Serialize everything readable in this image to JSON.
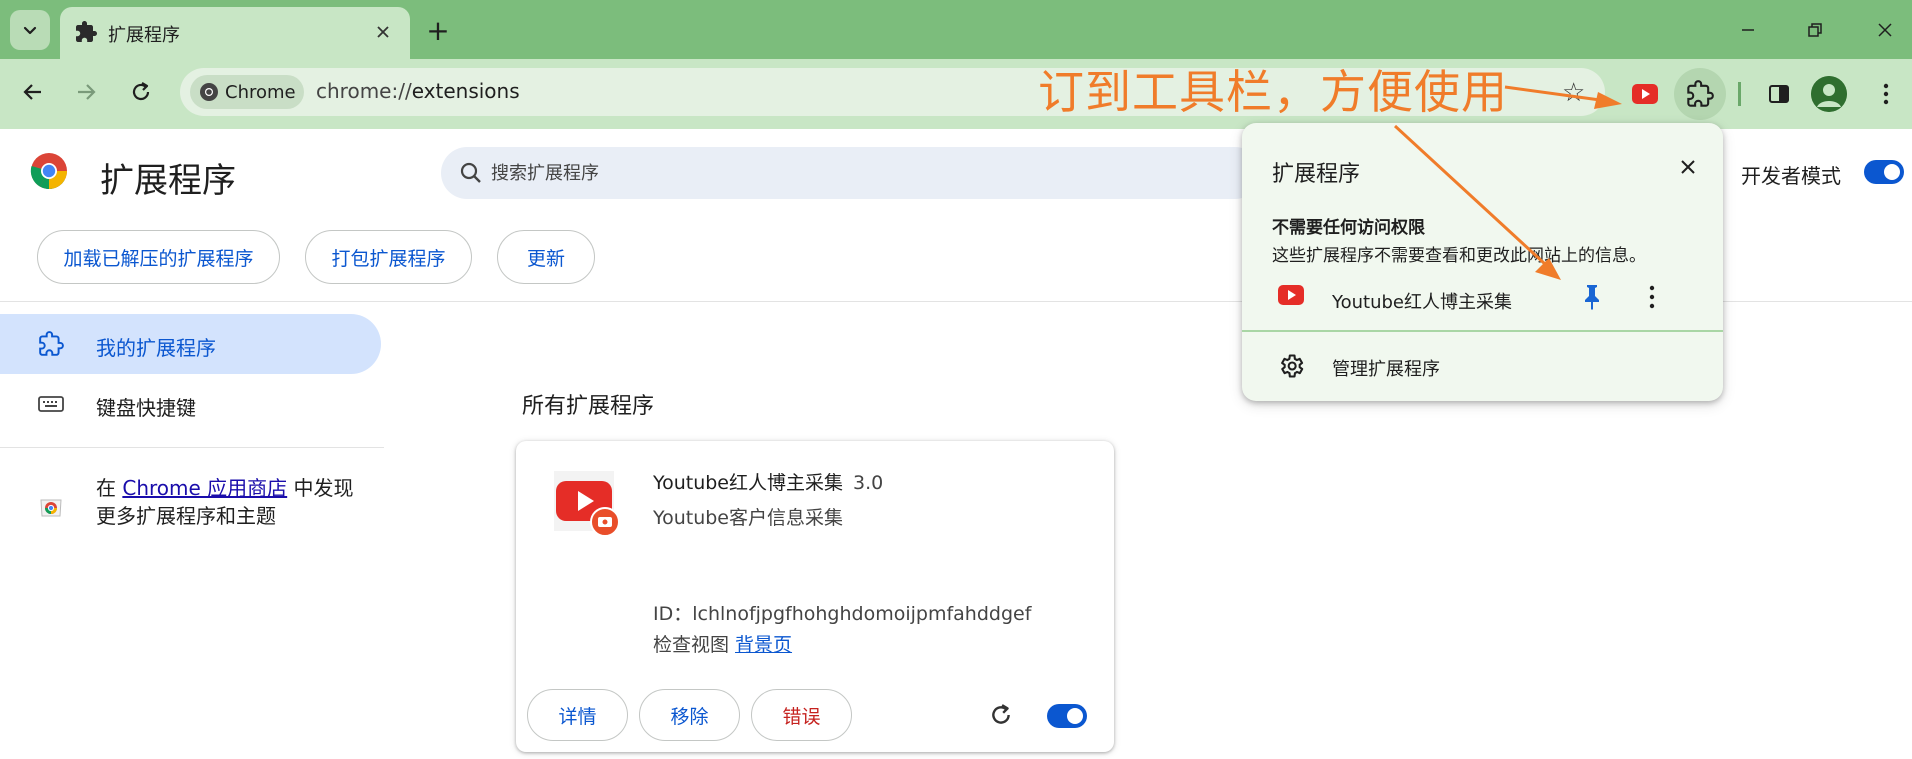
{
  "window": {
    "tab_title": "扩展程序",
    "tab_icon": "puzzle-icon",
    "new_tab_label": "+"
  },
  "toolbar": {
    "chip_label": "Chrome",
    "url_scheme": "chrome://",
    "url_host": "extensions",
    "annotation": "订到工具栏，方便使用"
  },
  "page": {
    "title": "扩展程序",
    "search_placeholder": "搜索扩展程序",
    "dev_mode_label": "开发者模式",
    "dev_mode_on": true,
    "actions": {
      "load_unpacked": "加载已解压的扩展程序",
      "pack": "打包扩展程序",
      "update": "更新"
    }
  },
  "sidebar": {
    "items": [
      {
        "label": "我的扩展程序",
        "active": true
      },
      {
        "label": "键盘快捷键",
        "active": false
      }
    ],
    "store_prefix": "在",
    "store_link": "Chrome 应用商店",
    "store_suffix": "中发现",
    "store_line2": "更多扩展程序和主题"
  },
  "main": {
    "section_title": "所有扩展程序",
    "card": {
      "name": "Youtube红人博主采集",
      "version": "3.0",
      "description": "Youtube客户信息采集",
      "id_label": "ID：",
      "id_value": "lchlnofjpgfhohghdomoijpmfahddgef",
      "inspect_label": "检查视图",
      "inspect_link": "背景页",
      "details_btn": "详情",
      "remove_btn": "移除",
      "errors_btn": "错误",
      "enabled": true
    }
  },
  "popup": {
    "title": "扩展程序",
    "section_title": "不需要任何访问权限",
    "section_desc": "这些扩展程序不需要查看和更改此网站上的信息。",
    "extension_name": "Youtube红人博主采集",
    "manage_label": "管理扩展程序"
  },
  "colors": {
    "accent": "#0b57d0",
    "titlebar": "#7cbd7c",
    "toolbar": "#c8e6c5",
    "annotation": "#f07c2a",
    "error": "#c5221f",
    "youtube": "#e52d27"
  }
}
